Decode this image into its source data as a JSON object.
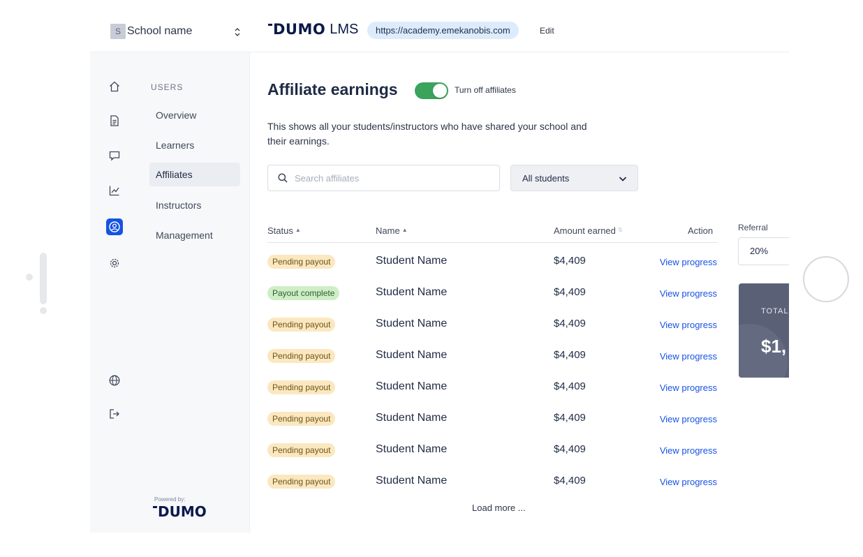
{
  "school": {
    "avatar_letter": "S",
    "name": "School name"
  },
  "brand": {
    "logo": "DUMO",
    "product": "LMS",
    "url": "https://academy.emekanobis.com",
    "edit_label": "Edit"
  },
  "rail_icons": [
    "home-icon",
    "document-icon",
    "chat-icon",
    "chart-icon",
    "user-circle-icon",
    "gear-icon",
    "globe-icon",
    "logout-icon"
  ],
  "subnav": {
    "heading": "USERS",
    "items": [
      "Overview",
      "Learners",
      "Affiliates",
      "Instructors",
      "Management"
    ],
    "active": "Affiliates",
    "powered_by": "Powered by:",
    "powered_logo": "DUMO"
  },
  "main": {
    "title": "Affiliate earnings",
    "toggle_label": "Turn off affiliates",
    "toggle_on": true,
    "description": "This shows all your students/instructors who have shared your school and their earnings.",
    "search_placeholder": "Search affiliates",
    "filter_value": "All students"
  },
  "table": {
    "headers": {
      "status": "Status",
      "name": "Name",
      "amount": "Amount earned",
      "action": "Action"
    },
    "rows": [
      {
        "status": "Pending payout",
        "type": "pending",
        "name": "Student Name",
        "amount": "$4,409",
        "action": "View progress"
      },
      {
        "status": "Payout complete",
        "type": "complete",
        "name": "Student Name",
        "amount": "$4,409",
        "action": "View progress"
      },
      {
        "status": "Pending payout",
        "type": "pending",
        "name": "Student Name",
        "amount": "$4,409",
        "action": "View progress"
      },
      {
        "status": "Pending payout",
        "type": "pending",
        "name": "Student Name",
        "amount": "$4,409",
        "action": "View progress"
      },
      {
        "status": "Pending payout",
        "type": "pending",
        "name": "Student Name",
        "amount": "$4,409",
        "action": "View progress"
      },
      {
        "status": "Pending payout",
        "type": "pending",
        "name": "Student Name",
        "amount": "$4,409",
        "action": "View progress"
      },
      {
        "status": "Pending payout",
        "type": "pending",
        "name": "Student Name",
        "amount": "$4,409",
        "action": "View progress"
      },
      {
        "status": "Pending payout",
        "type": "pending",
        "name": "Student Name",
        "amount": "$4,409",
        "action": "View progress"
      }
    ],
    "load_more": "Load more ..."
  },
  "referral": {
    "label": "Referral",
    "value": "20%"
  },
  "total": {
    "label": "TOTAL",
    "value": "$1,"
  },
  "colors": {
    "accent": "#1653e3",
    "toggle": "#3aa35c",
    "pending_bg": "#fbe8c0",
    "complete_bg": "#cdeec6",
    "card": "#5a6177"
  }
}
